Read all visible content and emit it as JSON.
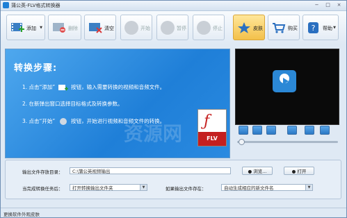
{
  "window": {
    "title": "蒲公英-FLV格式转换器",
    "minimize": "−",
    "maximize": "□",
    "close": "×"
  },
  "toolbar": {
    "add": "添加",
    "delete": "删除",
    "clear": "清空",
    "start": "开始",
    "pause": "暂停",
    "stop": "停止",
    "skin": "皮肤",
    "buy": "购买",
    "help": "帮助"
  },
  "preview": {
    "title": "转换步骤:",
    "step1_a": "1. 点击“添加”",
    "step1_b": "按钮，输入需要转换的视频和音频文件。",
    "step2": "2. 在新弹出窗口选择目标格式及转换参数。",
    "step3_a": "3. 点击“开始”",
    "step3_b": "按钮，开始进行视频和音频文件的转换。",
    "format_badge": "FLV",
    "watermark": "资源网"
  },
  "settings": {
    "output_dir_label": "输出文件存放目录：",
    "output_dir_value": "C:\\蒲公英视频输出",
    "browse": "浏览...",
    "open": "打开",
    "after_done_label": "当完成转换任务后：",
    "after_done_value": "打开转换输出文件夹",
    "if_exists_label": "如果输出文件存在：",
    "if_exists_value": "自动生成相应的新文件名"
  },
  "status": {
    "text": "更换软件外观皮肤"
  },
  "colors": {
    "accent": "#1f7fd8",
    "skin_button": "#f3c04a",
    "flv_red": "#c41f1f"
  }
}
